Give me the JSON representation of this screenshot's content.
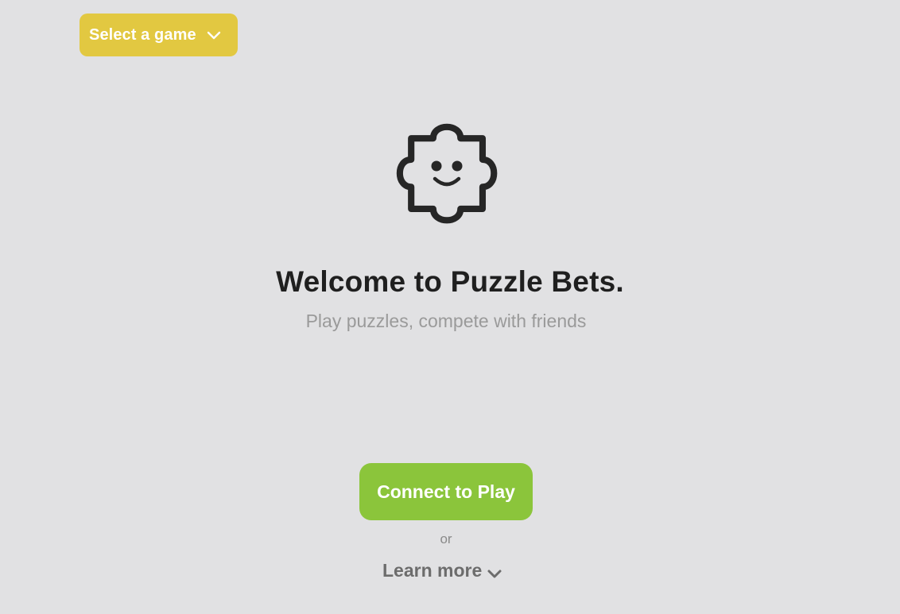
{
  "game_select": {
    "label": "Select a game",
    "icon": "chevron-down-icon",
    "color": "#e2c841"
  },
  "logo": {
    "icon": "smiling-puzzle-piece-icon"
  },
  "hero": {
    "title": "Welcome to Puzzle Bets.",
    "subtitle": "Play puzzles, compete with friends"
  },
  "actions": {
    "connect_label": "Connect to Play",
    "connect_color": "#8bc53b",
    "or_text": "or",
    "learn_more_label": "Learn more",
    "learn_more_icon": "chevron-down-icon"
  },
  "colors": {
    "background": "#e1e1e3",
    "title": "#1f1f1f",
    "subtitle": "#9a9a9a"
  }
}
